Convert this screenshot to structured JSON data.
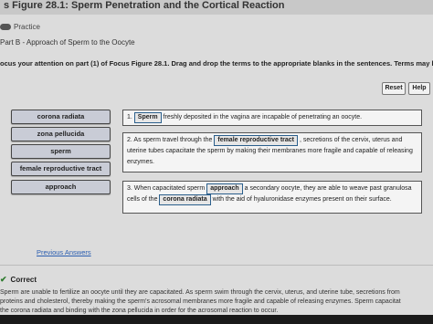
{
  "header": {
    "title": "s Figure 28.1: Sperm Penetration and the Cortical Reaction",
    "practice": "Practice",
    "part": "Part B - Approach of Sperm to the Oocyte"
  },
  "instructions": "ocus your attention on part (1) of Focus Figure 28.1. Drag and drop the terms to the appropriate blanks in the sentences. Terms may be used",
  "toolbar": {
    "reset": "Reset",
    "help": "Help"
  },
  "terms": [
    "corona radiata",
    "zona pellucida",
    "sperm",
    "female reproductive tract",
    "approach"
  ],
  "sentences": [
    {
      "num": "1.",
      "blank1": "Sperm",
      "text1": "freshly deposited in the vagina are incapable of penetrating an oocyte."
    },
    {
      "num": "2.",
      "pre": "As sperm travel through the",
      "blank1": "female reproductive tract",
      "text1": ", secretions of the cervix, uterus and",
      "line2": "uterine tubes capacitate the sperm by making their membranes more fragile and capable of releasing",
      "line3": "enzymes."
    },
    {
      "num": "3.",
      "pre": "When capacitated sperm",
      "blank1": "approach",
      "text1": "a secondary oocyte, they are able to weave past granulosa",
      "pre2": "cells of the",
      "blank2": "corona radiata",
      "text2": "with the aid of hyaluronidase enzymes present on their surface."
    }
  ],
  "links": {
    "previous_answers": "Previous Answers"
  },
  "feedback": {
    "status": "Correct",
    "lines": [
      "Sperm are unable to fertilize an oocyte until they are capacitated. As sperm swim through the cervix, uterus, and uterine tube, secretions from",
      "proteins and cholesterol, thereby making the sperm's acrosomal membranes more fragile and capable of releasing enzymes. Sperm capacitat",
      "the corona radiata and binding with the zona pellucida in order for the acrosomal reaction to occur."
    ]
  }
}
